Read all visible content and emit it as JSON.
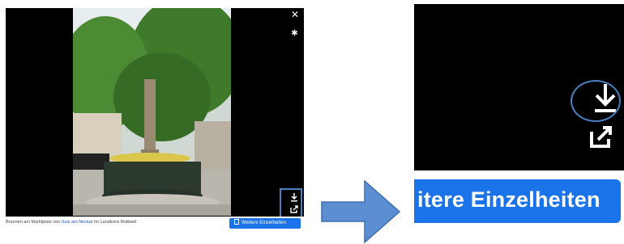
{
  "viewer": {
    "close_icon": "close-icon",
    "settings_icon": "gear-icon",
    "download_icon": "download-icon",
    "share_icon": "share-icon"
  },
  "caption": {
    "prefix": "Brunnen am Marktplatz von ",
    "link1": "Sulz am Neckar",
    "suffix": " im Landkreis Rottweil"
  },
  "details_button_small": {
    "label": "Weitere Einzelheiten"
  },
  "details_button_zoom": {
    "label": "itere Einzelheiten"
  },
  "colors": {
    "accent": "#1a73e8",
    "highlight": "#4a7fc1",
    "arrow": "#5b8fd1"
  }
}
